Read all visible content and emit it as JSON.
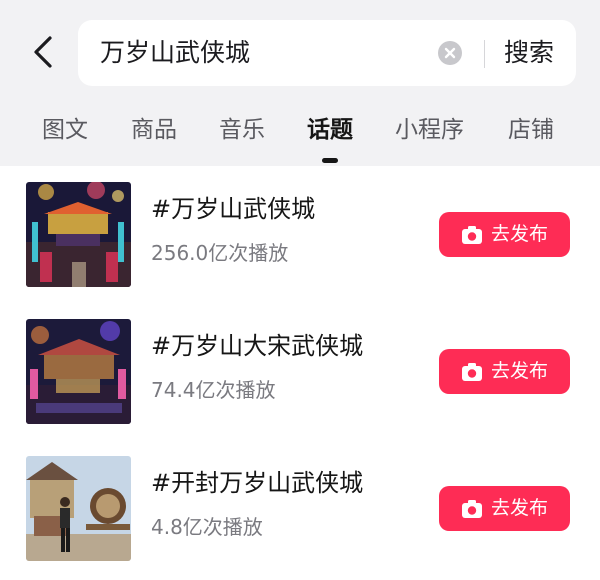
{
  "search": {
    "query": "万岁山武侠城",
    "button_label": "搜索"
  },
  "tabs": [
    {
      "label": "图文"
    },
    {
      "label": "商品"
    },
    {
      "label": "音乐"
    },
    {
      "label": "话题",
      "active": true
    },
    {
      "label": "小程序"
    },
    {
      "label": "店铺"
    }
  ],
  "topics": [
    {
      "title": "#万岁山武侠城",
      "plays": "256.0亿次播放",
      "button_label": "去发布"
    },
    {
      "title": "#万岁山大宋武侠城",
      "plays": "74.4亿次播放",
      "button_label": "去发布"
    },
    {
      "title": "#开封万岁山武侠城",
      "plays": "4.8亿次播放",
      "button_label": "去发布"
    }
  ],
  "colors": {
    "accent": "#fe2c55",
    "header_bg": "#f2f2f4",
    "text_primary": "#161616",
    "text_secondary": "#7a7a80"
  }
}
